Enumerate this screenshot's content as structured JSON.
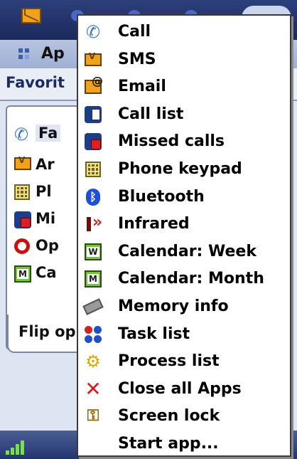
{
  "apps_row": {
    "label": "Ap"
  },
  "favorites_header": {
    "label": "Favorit"
  },
  "favorites_list": [
    {
      "label": "Fa",
      "icon": "phone-icon",
      "selected": true
    },
    {
      "label": "Ar",
      "icon": "envelope-icon"
    },
    {
      "label": "Pl",
      "icon": "keypad-icon"
    },
    {
      "label": "Mi",
      "icon": "missed-calls-icon"
    },
    {
      "label": "Op",
      "icon": "opera-icon"
    },
    {
      "label": "Ca",
      "icon": "calendar-icon"
    }
  ],
  "flip_tab": {
    "label": "Flip op"
  },
  "menu": {
    "items": [
      {
        "label": "Call",
        "icon": "phone-icon"
      },
      {
        "label": "SMS",
        "icon": "envelope-icon"
      },
      {
        "label": "Email",
        "icon": "email-icon"
      },
      {
        "label": "Call list",
        "icon": "call-list-icon"
      },
      {
        "label": "Missed calls",
        "icon": "missed-calls-icon"
      },
      {
        "label": "Phone keypad",
        "icon": "keypad-icon"
      },
      {
        "label": "Bluetooth",
        "icon": "bluetooth-icon"
      },
      {
        "label": "Infrared",
        "icon": "infrared-icon"
      },
      {
        "label": "Calendar: Week",
        "icon": "calendar-week-icon",
        "icon_text": "W"
      },
      {
        "label": "Calendar: Month",
        "icon": "calendar-month-icon",
        "icon_text": "M"
      },
      {
        "label": "Memory info",
        "icon": "memory-chip-icon"
      },
      {
        "label": "Task list",
        "icon": "task-list-icon"
      },
      {
        "label": "Process list",
        "icon": "gear-icon"
      },
      {
        "label": "Close all Apps",
        "icon": "close-icon"
      },
      {
        "label": "Screen lock",
        "icon": "key-icon"
      },
      {
        "label": "Start app...",
        "icon": ""
      }
    ]
  },
  "favorites_calendar_icon_text": "M",
  "colors": {
    "topbar": "#1b2a5c",
    "menu_bg": "#ffffff",
    "accent_blue": "#1f4fd8",
    "close_red": "#e01818"
  }
}
